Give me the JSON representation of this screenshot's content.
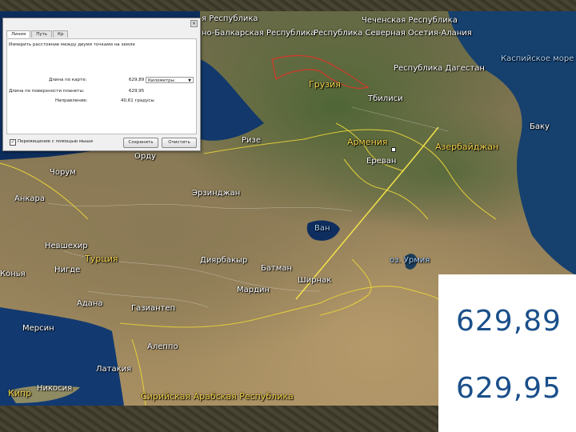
{
  "dialog": {
    "tabs": [
      "Линия",
      "Путь",
      "Кр"
    ],
    "description": "Измерить расстояние между двумя точками на земле",
    "map_length_label": "Длина по карте:",
    "map_length_value": "629,89",
    "unit_selected": "Километры",
    "ground_length_label": "Длина по поверхности планеты:",
    "ground_length_value": "629,95",
    "heading_label": "Направление:",
    "heading_value": "40,61 градусы",
    "checkbox_label": "Перемещение с помощью мыши",
    "save_button": "Сохранить",
    "clear_button": "Очистить"
  },
  "map_labels": [
    {
      "text": "Чеченская Республика",
      "kind": "region"
    },
    {
      "text": "я Республика",
      "kind": "region"
    },
    {
      "text": "но-Балкарская Республика",
      "kind": "region"
    },
    {
      "text": "Республика Северная Осетия-Алания",
      "kind": "region"
    },
    {
      "text": "Республика Дагестан",
      "kind": "region"
    },
    {
      "text": "Каспийское море",
      "kind": "water"
    },
    {
      "text": "Грузия",
      "kind": "country"
    },
    {
      "text": "Тбилиси",
      "kind": "city"
    },
    {
      "text": "Баку",
      "kind": "city"
    },
    {
      "text": "Армения",
      "kind": "country"
    },
    {
      "text": "Азербайджан",
      "kind": "country"
    },
    {
      "text": "Ереван",
      "kind": "city"
    },
    {
      "text": "Ризе",
      "kind": "city"
    },
    {
      "text": "Орду",
      "kind": "city"
    },
    {
      "text": "Чорум",
      "kind": "city"
    },
    {
      "text": "Анкара",
      "kind": "city"
    },
    {
      "text": "Эрзинджан",
      "kind": "city"
    },
    {
      "text": "Ван",
      "kind": "water"
    },
    {
      "text": "Невшехир",
      "kind": "city"
    },
    {
      "text": "Турция",
      "kind": "country"
    },
    {
      "text": "Нигде",
      "kind": "city"
    },
    {
      "text": "Конья",
      "kind": "city"
    },
    {
      "text": "Диярбакыр",
      "kind": "city"
    },
    {
      "text": "Батман",
      "kind": "city"
    },
    {
      "text": "Ширнак",
      "kind": "city"
    },
    {
      "text": "оз. Урмия",
      "kind": "water"
    },
    {
      "text": "Мардин",
      "kind": "city"
    },
    {
      "text": "Адана",
      "kind": "city"
    },
    {
      "text": "Газиантеп",
      "kind": "city"
    },
    {
      "text": "Мерсин",
      "kind": "city"
    },
    {
      "text": "Алеппо",
      "kind": "city"
    },
    {
      "text": "Латакия",
      "kind": "city"
    },
    {
      "text": "Кипр",
      "kind": "country"
    },
    {
      "text": "Никосия",
      "kind": "city"
    },
    {
      "text": "Сирийская Арабская Республика",
      "kind": "country"
    }
  ],
  "callout": {
    "value_map": "629,89",
    "value_ground": "629,95"
  }
}
